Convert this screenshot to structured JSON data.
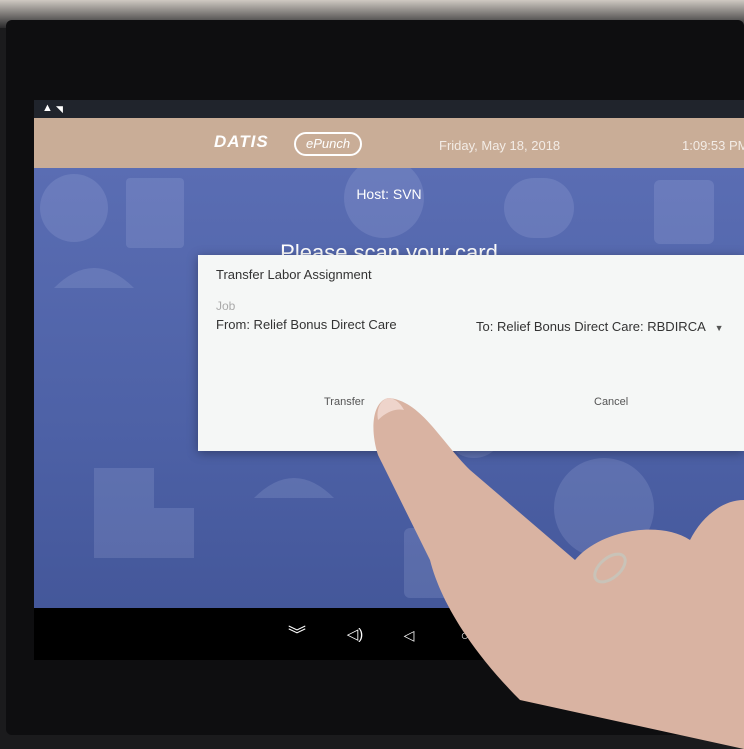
{
  "status_bar": {
    "warning_icon": "warning-icon",
    "wifi_icon": "wifi-icon"
  },
  "app": {
    "logo": "DATIS",
    "product": "ePunch",
    "date": "Friday, May 18, 2018",
    "time": "1:09:53 PM",
    "host": "Host: SVN",
    "prompt": "Please scan your card"
  },
  "dialog": {
    "title": "Transfer Labor Assignment",
    "job_label": "Job",
    "from_text": "From: Relief Bonus Direct Care",
    "to_label": "To:",
    "to_value": "Relief Bonus Direct Care: RBDIRCA",
    "transfer_label": "Transfer",
    "cancel_label": "Cancel"
  },
  "nav_bar": {
    "icons": [
      "collapse-icon",
      "volume-icon",
      "back-icon",
      "home-icon"
    ]
  },
  "colors": {
    "appbar": "#c9ad97",
    "screen_bg": "#4f63a5",
    "dialog_bg": "#f5f7f6"
  }
}
